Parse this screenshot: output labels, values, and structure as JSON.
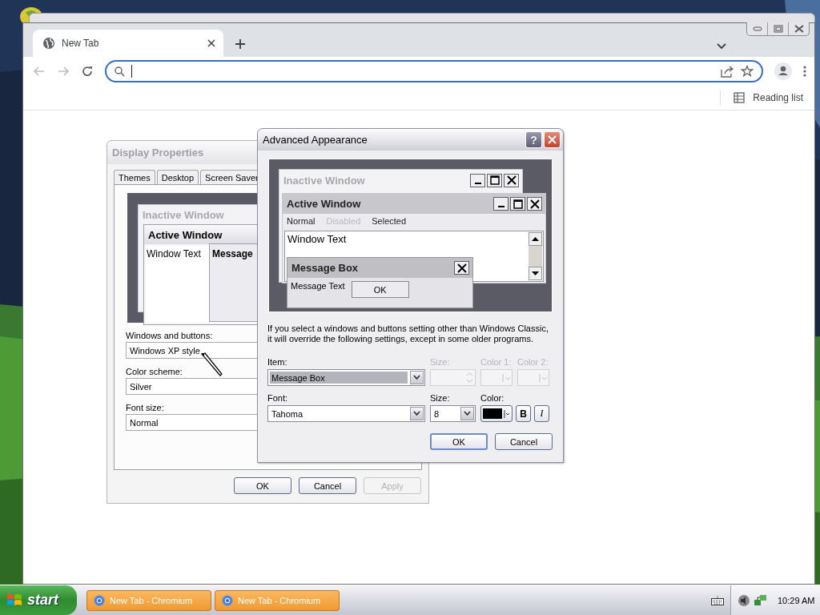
{
  "browser": {
    "tabs": [
      {
        "title": "New Tab",
        "selected": true
      }
    ],
    "nav": {
      "back": {
        "disabled": true
      },
      "forward": {
        "disabled": true
      }
    },
    "reading_list": "Reading list"
  },
  "display_properties": {
    "title": "Display Properties",
    "active": false,
    "tabs": [
      {
        "label": "Themes",
        "selected": false
      },
      {
        "label": "Desktop",
        "selected": false
      },
      {
        "label": "Screen Saver",
        "selected": false
      }
    ],
    "preview": {
      "inactive_title": "Inactive Window",
      "active_title": "Active Window",
      "window_text": "Window Text",
      "message_title": "Message"
    },
    "fields": [
      {
        "label": "Windows and buttons:",
        "value": "Windows XP style"
      },
      {
        "label": "Color scheme:",
        "value": "Silver"
      },
      {
        "label": "Font size:",
        "value": "Normal"
      }
    ],
    "buttons": [
      {
        "label": "OK",
        "disabled": false
      },
      {
        "label": "Cancel",
        "disabled": false
      },
      {
        "label": "Apply",
        "disabled": true
      }
    ]
  },
  "advanced_appearance": {
    "title": "Advanced Appearance",
    "help": "?",
    "preview": {
      "inactive_title": "Inactive Window",
      "active_title": "Active Window",
      "menu": [
        {
          "label": "Normal",
          "kind": "normal"
        },
        {
          "label": "Disabled",
          "kind": "disabled"
        },
        {
          "label": "Selected",
          "kind": "selected"
        }
      ],
      "window_text": "Window Text",
      "message_title": "Message Box",
      "message_text": "Message Text",
      "message_button": "OK"
    },
    "note": "If you select a windows and buttons setting other than Windows Classic, it will override the following settings, except in some older programs.",
    "item": {
      "label": "Item:",
      "value": "Message Box"
    },
    "item_size": {
      "label": "Size:",
      "disabled": true
    },
    "color_1": {
      "label": "Color 1:",
      "disabled": true
    },
    "color_2": {
      "label": "Color 2:",
      "disabled": true
    },
    "font": {
      "label": "Font:",
      "value": "Tahoma"
    },
    "font_size": {
      "label": "Size:",
      "value": "8"
    },
    "font_color": {
      "label": "Color:"
    },
    "bold": {
      "label": "B",
      "selected": false
    },
    "italic": {
      "label": "I",
      "selected": false
    },
    "buttons": [
      {
        "label": "OK",
        "default": true
      },
      {
        "label": "Cancel",
        "default": false
      }
    ]
  },
  "taskbar": {
    "start": "start",
    "tasks": [
      {
        "label": "New Tab - Chromium",
        "selected": false
      },
      {
        "label": "New Tab - Chromium",
        "selected": false
      }
    ],
    "clock": "10:29 AM"
  }
}
